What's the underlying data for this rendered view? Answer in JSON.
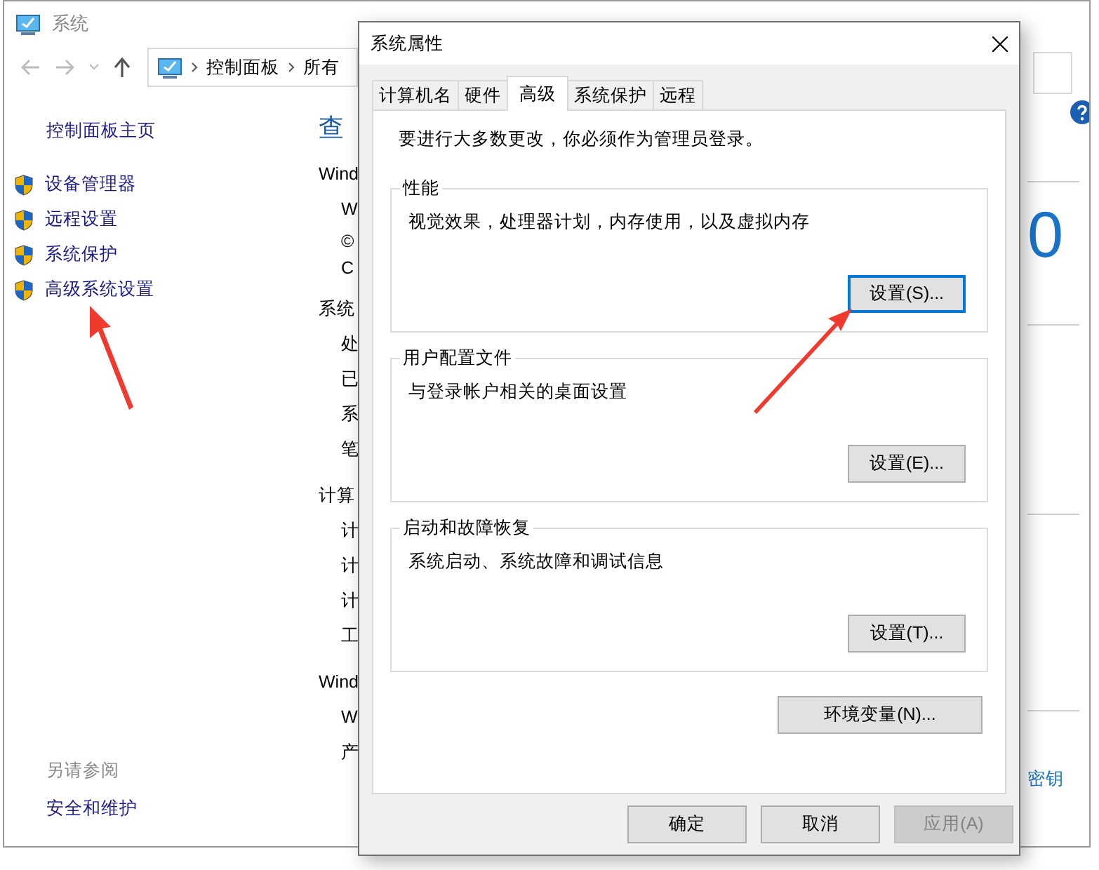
{
  "window": {
    "title": "系统",
    "breadcrumb": [
      "控制面板",
      "所有"
    ]
  },
  "sidebar": {
    "home": "控制面板主页",
    "items": [
      {
        "label": "设备管理器"
      },
      {
        "label": "远程设置"
      },
      {
        "label": "系统保护"
      },
      {
        "label": "高级系统设置"
      }
    ],
    "see_also": {
      "title": "另请参阅",
      "links": [
        "安全和维护"
      ]
    }
  },
  "content": {
    "heading": "查",
    "lines": [
      {
        "kind": "section",
        "text": "Wind"
      },
      {
        "kind": "item",
        "text": "W"
      },
      {
        "kind": "note",
        "text": "©"
      },
      {
        "kind": "note",
        "text": "C"
      },
      {
        "kind": "section",
        "text": "系统"
      },
      {
        "kind": "item",
        "text": "处"
      },
      {
        "kind": "item",
        "text": "已"
      },
      {
        "kind": "item",
        "text": "系"
      },
      {
        "kind": "item",
        "text": "笔"
      },
      {
        "kind": "section",
        "text": "计算"
      },
      {
        "kind": "item",
        "text": "计"
      },
      {
        "kind": "item",
        "text": "计"
      },
      {
        "kind": "item",
        "text": "计"
      },
      {
        "kind": "item",
        "text": "工"
      },
      {
        "kind": "section",
        "text": "Wind"
      },
      {
        "kind": "item",
        "text": "W"
      },
      {
        "kind": "item",
        "text": "产"
      }
    ]
  },
  "right_column": {
    "big_text": "0",
    "link": "密钥"
  },
  "dialog": {
    "title": "系统属性",
    "tabs": [
      {
        "label": "计算机名",
        "selected": false
      },
      {
        "label": "硬件",
        "selected": false
      },
      {
        "label": "高级",
        "selected": true
      },
      {
        "label": "系统保护",
        "selected": false
      },
      {
        "label": "远程",
        "selected": false
      }
    ],
    "notice": "要进行大多数更改，你必须作为管理员登录。",
    "groups": [
      {
        "title": "性能",
        "description": "视觉效果，处理器计划，内存使用，以及虚拟内存",
        "button": {
          "label": "设置(S)...",
          "focused": true
        }
      },
      {
        "title": "用户配置文件",
        "description": "与登录帐户相关的桌面设置",
        "button": {
          "label": "设置(E)...",
          "focused": false
        }
      },
      {
        "title": "启动和故障恢复",
        "description": "系统启动、系统故障和调试信息",
        "button": {
          "label": "设置(T)...",
          "focused": false
        }
      }
    ],
    "env_button": {
      "label": "环境变量(N)...",
      "focused": false
    },
    "buttons": [
      {
        "label": "确定",
        "disabled": false
      },
      {
        "label": "取消",
        "disabled": false
      },
      {
        "label": "应用(A)",
        "disabled": true
      }
    ]
  }
}
